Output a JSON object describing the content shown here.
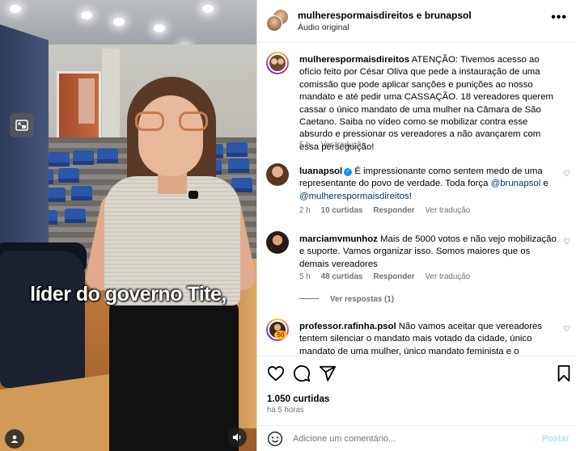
{
  "video": {
    "caption": "líder do governo Tite,",
    "icons": {
      "pip": "picture-in-picture-icon",
      "user": "user-tag-icon",
      "audio": "audio-icon"
    }
  },
  "header": {
    "names": "mulherespormaisdireitos e brunapsol",
    "subtitle": "Áudio original",
    "more": "•••"
  },
  "caption_comment": {
    "username": "mulherespormaisdireitos",
    "text": " ATENÇÃO: Tivemos acesso ao ofício feito por César Oliva que pede a instauração de uma comissão que pode aplicar sanções e punições ao nosso mandato e até pedir uma CASSAÇÃO. 18 vereadores querem cassar o único mandato de uma mulher na Câmara de São Caetano. Saiba no vídeo como se mobilizar contra esse absurdo e pressionar os vereadores a não avançarem com essa perseguição!",
    "time": "5 h",
    "translate": "Ver tradução"
  },
  "comments": [
    {
      "username": "luanapsol",
      "verified": true,
      "text_a": " É impressionante como sentem medo de uma representante do povo de verdade. Toda força ",
      "mention_1": "@brunapsol",
      "text_b": " e ",
      "mention_2": "@mulherespormaisdireitos",
      "text_c": "!",
      "time": "2 h",
      "likes": "10 curtidas",
      "reply": "Responder",
      "translate": "Ver tradução"
    },
    {
      "username": "marciamvmunhoz",
      "text": " Mais de 5000 votos e não vejo mobilização e suporte. Vamos organizar isso. Somos maiores que os demais vereadores",
      "time": "5 h",
      "likes": "48 curtidas",
      "reply": "Responder",
      "translate": "Ver tradução",
      "view_replies": "Ver respostas (1)"
    },
    {
      "username": "professor.rafinha.psol",
      "text": " Não vamos aceitar que vereadores tentem silenciar o mandato mais votado da cidade, único mandato de uma mulher, único mandato feminista e o",
      "badge": "50"
    }
  ],
  "post": {
    "likes": "1.050 curtidas",
    "time": "há 5 horas"
  },
  "add_comment": {
    "placeholder": "Adicione um comentário...",
    "post_label": "Postar"
  },
  "colors": {
    "link": "#00376b",
    "meta": "#737373",
    "verified": "#0095f6",
    "post_disabled": "#b2dffc"
  }
}
